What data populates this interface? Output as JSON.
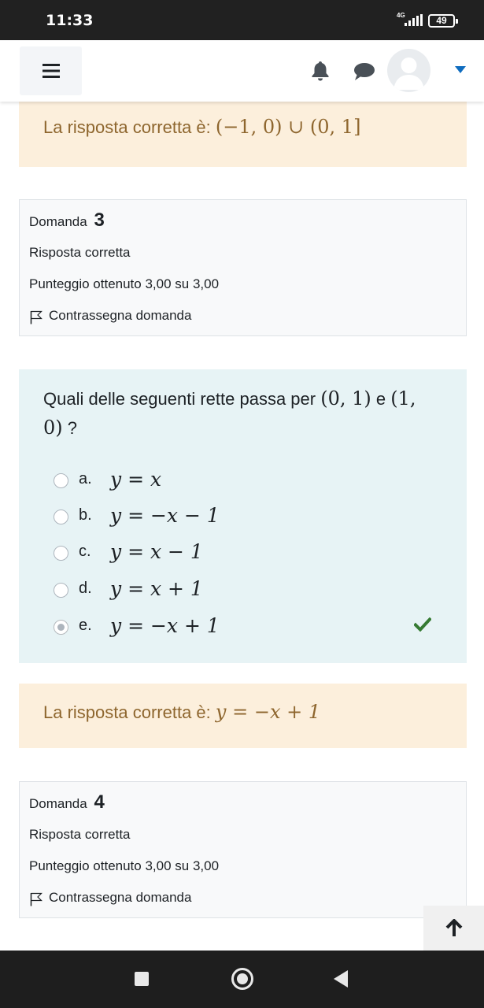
{
  "status_bar": {
    "time": "11:33",
    "network": "4G",
    "battery": "49"
  },
  "navbar": {
    "menu_icon": "hamburger-icon",
    "notification_icon": "bell-icon",
    "messages_icon": "chat-icon",
    "avatar_icon": "user-avatar",
    "dropdown_icon": "caret-down-icon"
  },
  "feedback_q2": {
    "label": "La risposta corretta è:",
    "answer": "(−1, 0) ∪ (0, 1]"
  },
  "question3_info": {
    "domanda_label": "Domanda",
    "number": "3",
    "status": "Risposta corretta",
    "score": "Punteggio ottenuto 3,00 su 3,00",
    "flag_label": "Contrassegna domanda"
  },
  "question3": {
    "text_prefix": "Quali delle seguenti rette passa per",
    "point1": "(0, 1)",
    "conjunction": "e",
    "point2": "(1, 0)",
    "text_suffix": "?",
    "options": [
      {
        "letter": "a.",
        "formula": "y = x",
        "selected": false
      },
      {
        "letter": "b.",
        "formula": "y = −x − 1",
        "selected": false
      },
      {
        "letter": "c.",
        "formula": "y = x − 1",
        "selected": false
      },
      {
        "letter": "d.",
        "formula": "y = x + 1",
        "selected": false
      },
      {
        "letter": "e.",
        "formula": "y = −x + 1",
        "selected": true
      }
    ],
    "correct_color": "#357a32"
  },
  "feedback_q3": {
    "label": "La risposta corretta è:",
    "answer": "y = −x + 1"
  },
  "question4_info": {
    "domanda_label": "Domanda",
    "number": "4",
    "status": "Risposta corretta",
    "score": "Punteggio ottenuto 3,00 su 3,00",
    "flag_label": "Contrassegna domanda"
  },
  "colors": {
    "feedback_bg": "#fcefdc",
    "feedback_text": "#8e662e",
    "question_bg": "#e7f3f5",
    "accent": "#0f6cbf"
  }
}
